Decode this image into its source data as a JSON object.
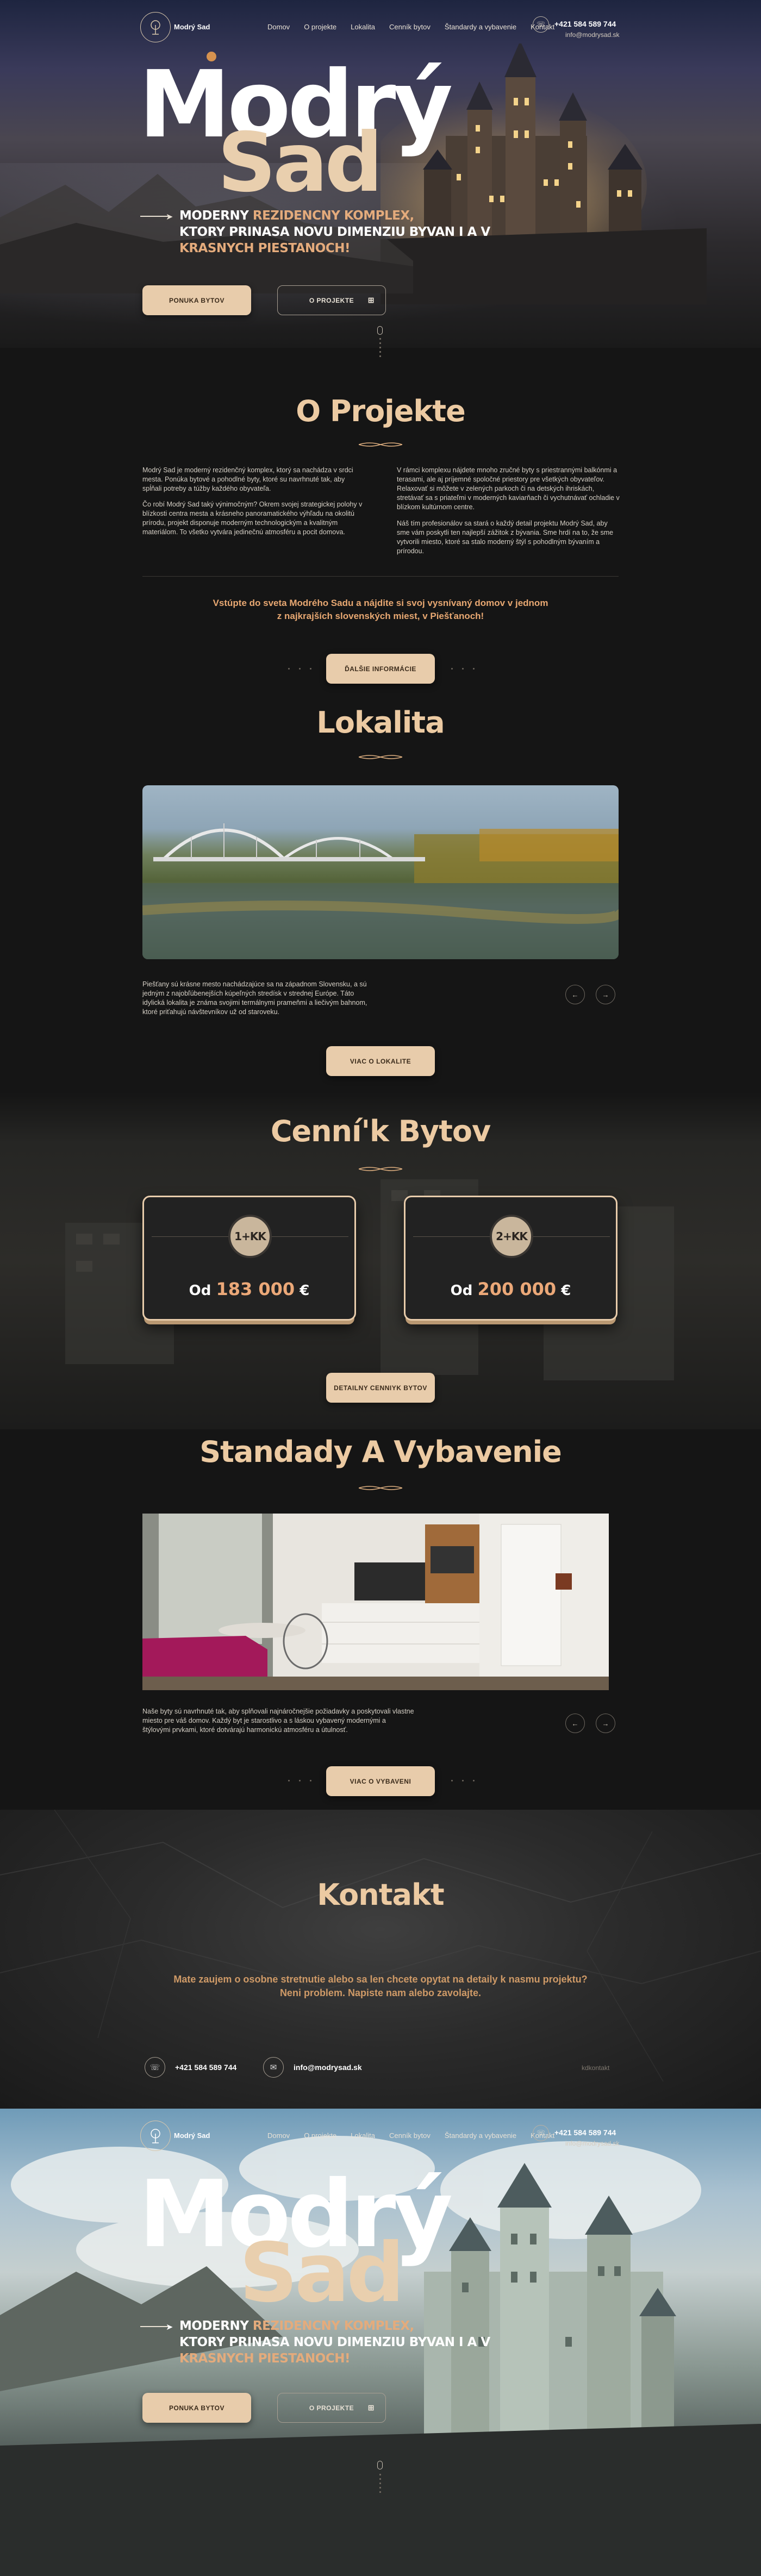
{
  "nav": {
    "brand": "Modrý Sad",
    "menu": [
      "Domov",
      "O projekte",
      "Lokalita",
      "Cenník bytov",
      "Štandardy a vybavenie",
      "Kontakt"
    ],
    "phone": "+421 584 589 744",
    "email": "info@modrysad.sk"
  },
  "hero": {
    "title1": "Modrý",
    "title2": "Sad",
    "tag_a": "MODERNY ",
    "tag_b": "REZIDENCNY KOMPLEX,",
    "tag_c": "KTORY PRINASA NOVU DIMENZIU BYVAN I A V",
    "tag_d": "KRASNYCH PIESTANOCH!",
    "btn1": "PONUKA BYTOV",
    "btn2": "O PROJEKTE"
  },
  "about": {
    "title": "O Projekte",
    "p1": "Modrý Sad je moderný rezidenčný komplex, ktorý sa nachádza v srdci mesta. Ponúka bytové a pohodlné byty, ktoré su navrhnuté tak, aby spĺňali potreby a túžby každého obyvateľa.",
    "p2": "Čo robí Modrý Sad taký výnimočným? Okrem svojej strategickej polohy v blízkosti centra mesta a krásneho panoramatického výhľadu na okolitú prírodu, projekt disponuje moderným technologickým a kvalitným materiálom. To všetko vytvára jedinečnú atmosféru a pocit domova.",
    "p3": "V rámci komplexu nájdete mnoho zručné byty s priestrannými balkónmi a terasami, ale aj príjemné spoločné priestory pre všetkých obyvateľov. Relaxovať si môžete v zelených parkoch či na detských ihriskách, stretávať sa s priateľmi v moderných kaviarňach či vychutnávať ochladie v blízkom kultúrnom centre.",
    "p4": "Náš tím profesionálov sa stará o každý detail projektu Modrý Sad, aby sme vám poskytli ten najlepší zážitok z bývania. Sme hrdí na to, že sme vytvorili miesto, ktoré sa stalo moderný štýl s pohodlným bývaním a prírodou.",
    "cta1": "Vstúpte do sveta Modrého Sadu a nájdite si svoj vysnívaný domov v jednom",
    "cta2": "z najkrajších slovenských miest, v Piešťanoch!",
    "btn": "ĎALŠIE INFORMÁCIE"
  },
  "loc": {
    "title": "Lokalita",
    "text": "Piešťany sú krásne mesto nachádzajúce sa na západnom Slovensku, a sú jedným z najobľúbenejších kúpeľných stredísk v strednej Európe. Táto idylická lokalita je známa svojimi termálnymi prameňmi a liečivým bahnom, ktoré priťahujú návštevníkov už od staroveku.",
    "btn": "VIAC O LOKALITE"
  },
  "price": {
    "title": "Cenní'k Bytov",
    "c1": {
      "badge": "1+KK",
      "od": "Od ",
      "val": "183 000",
      "cur": " €"
    },
    "c2": {
      "badge": "2+KK",
      "od": "Od ",
      "val": "200 000",
      "cur": " €"
    },
    "btn": "DETAILNY CENNIYK BYTOV"
  },
  "std": {
    "title": "Standady A Vybavenie",
    "text": "Naše byty sú navrhnuté tak, aby splňovali najnáročnejšie požiadavky a poskytovali vlastne miesto pre váš domov. Každý byt je starostlivo a s láskou vybavený modernými a štýlovými prvkami, ktoré dotvárajú harmonickú atmosféru a útulnosť.",
    "btn": "VIAC O VYBAVENI"
  },
  "contact": {
    "title": "Kontakt",
    "t1": "Mate zaujem o osobne stretnutie alebo sa len chcete opytat na detaily k nasmu projektu?",
    "t2": "Neni problem. Napiste nam alebo zavolajte.",
    "phone": "+421 584 589 744",
    "email": "info@modrysad.sk",
    "link": "kdkontakt"
  },
  "colors": {
    "accent": "#eccaa2",
    "orange": "#e8a872",
    "button": "#e8ccab"
  }
}
